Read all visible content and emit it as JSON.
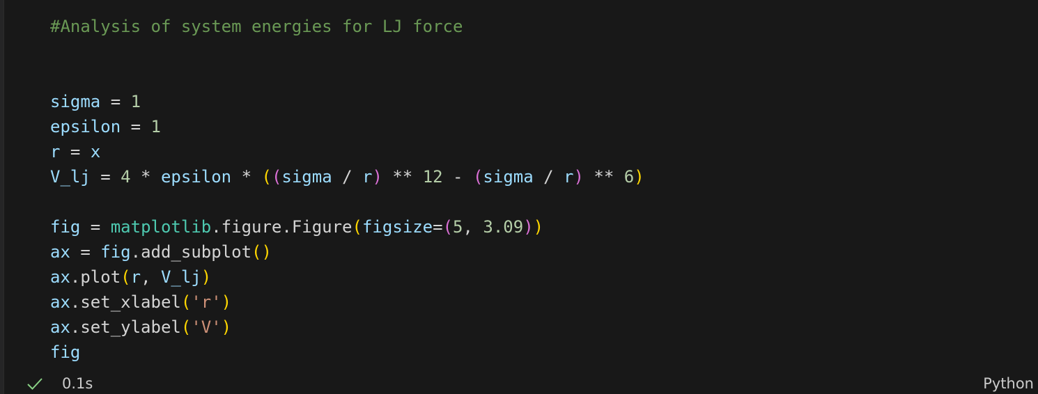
{
  "code_lines": [
    [
      {
        "t": "#Analysis of system energies for LJ force",
        "k": "comment"
      }
    ],
    [],
    [],
    [
      {
        "t": "sigma",
        "k": "var"
      },
      {
        "t": " = ",
        "k": "op"
      },
      {
        "t": "1",
        "k": "num"
      }
    ],
    [
      {
        "t": "epsilon",
        "k": "var"
      },
      {
        "t": " = ",
        "k": "op"
      },
      {
        "t": "1",
        "k": "num"
      }
    ],
    [
      {
        "t": "r",
        "k": "var"
      },
      {
        "t": " = ",
        "k": "op"
      },
      {
        "t": "x",
        "k": "var"
      }
    ],
    [
      {
        "t": "V_lj",
        "k": "var"
      },
      {
        "t": " = ",
        "k": "op"
      },
      {
        "t": "4",
        "k": "num"
      },
      {
        "t": " * ",
        "k": "op"
      },
      {
        "t": "epsilon",
        "k": "var"
      },
      {
        "t": " * ",
        "k": "op"
      },
      {
        "t": "(",
        "k": "p1"
      },
      {
        "t": "(",
        "k": "p2"
      },
      {
        "t": "sigma",
        "k": "var"
      },
      {
        "t": " / ",
        "k": "op"
      },
      {
        "t": "r",
        "k": "var"
      },
      {
        "t": ")",
        "k": "p2"
      },
      {
        "t": " ** ",
        "k": "op"
      },
      {
        "t": "12",
        "k": "num"
      },
      {
        "t": " - ",
        "k": "op"
      },
      {
        "t": "(",
        "k": "p2"
      },
      {
        "t": "sigma",
        "k": "var"
      },
      {
        "t": " / ",
        "k": "op"
      },
      {
        "t": "r",
        "k": "var"
      },
      {
        "t": ")",
        "k": "p2"
      },
      {
        "t": " ** ",
        "k": "op"
      },
      {
        "t": "6",
        "k": "num"
      },
      {
        "t": ")",
        "k": "p1"
      }
    ],
    [],
    [
      {
        "t": "fig",
        "k": "var"
      },
      {
        "t": " = ",
        "k": "op"
      },
      {
        "t": "matplotlib",
        "k": "mod"
      },
      {
        "t": ".figure.Figure",
        "k": "plain"
      },
      {
        "t": "(",
        "k": "p1"
      },
      {
        "t": "figsize",
        "k": "var"
      },
      {
        "t": "=",
        "k": "op"
      },
      {
        "t": "(",
        "k": "p2"
      },
      {
        "t": "5",
        "k": "num"
      },
      {
        "t": ", ",
        "k": "plain"
      },
      {
        "t": "3.09",
        "k": "num"
      },
      {
        "t": ")",
        "k": "p2"
      },
      {
        "t": ")",
        "k": "p1"
      }
    ],
    [
      {
        "t": "ax",
        "k": "var"
      },
      {
        "t": " = ",
        "k": "op"
      },
      {
        "t": "fig",
        "k": "var"
      },
      {
        "t": ".add_subplot",
        "k": "plain"
      },
      {
        "t": "()",
        "k": "p1"
      }
    ],
    [
      {
        "t": "ax",
        "k": "var"
      },
      {
        "t": ".plot",
        "k": "plain"
      },
      {
        "t": "(",
        "k": "p1"
      },
      {
        "t": "r",
        "k": "var"
      },
      {
        "t": ", ",
        "k": "plain"
      },
      {
        "t": "V_lj",
        "k": "var"
      },
      {
        "t": ")",
        "k": "p1"
      }
    ],
    [
      {
        "t": "ax",
        "k": "var"
      },
      {
        "t": ".set_xlabel",
        "k": "plain"
      },
      {
        "t": "(",
        "k": "p1"
      },
      {
        "t": "'r'",
        "k": "str"
      },
      {
        "t": ")",
        "k": "p1"
      }
    ],
    [
      {
        "t": "ax",
        "k": "var"
      },
      {
        "t": ".set_ylabel",
        "k": "plain"
      },
      {
        "t": "(",
        "k": "p1"
      },
      {
        "t": "'V'",
        "k": "str"
      },
      {
        "t": ")",
        "k": "p1"
      }
    ],
    [
      {
        "t": "fig",
        "k": "var"
      }
    ]
  ],
  "status": {
    "check_icon": "check-icon",
    "exec_time": "0.1s",
    "language": "Python"
  },
  "colors": {
    "background": "#181818",
    "comment": "#6a9955",
    "variable": "#9cdcfe",
    "module": "#4ec9b0",
    "number": "#b5cea8",
    "string": "#ce9178",
    "bracket_level1": "#ffd700",
    "bracket_level2": "#da70d6",
    "check": "#89d185"
  }
}
